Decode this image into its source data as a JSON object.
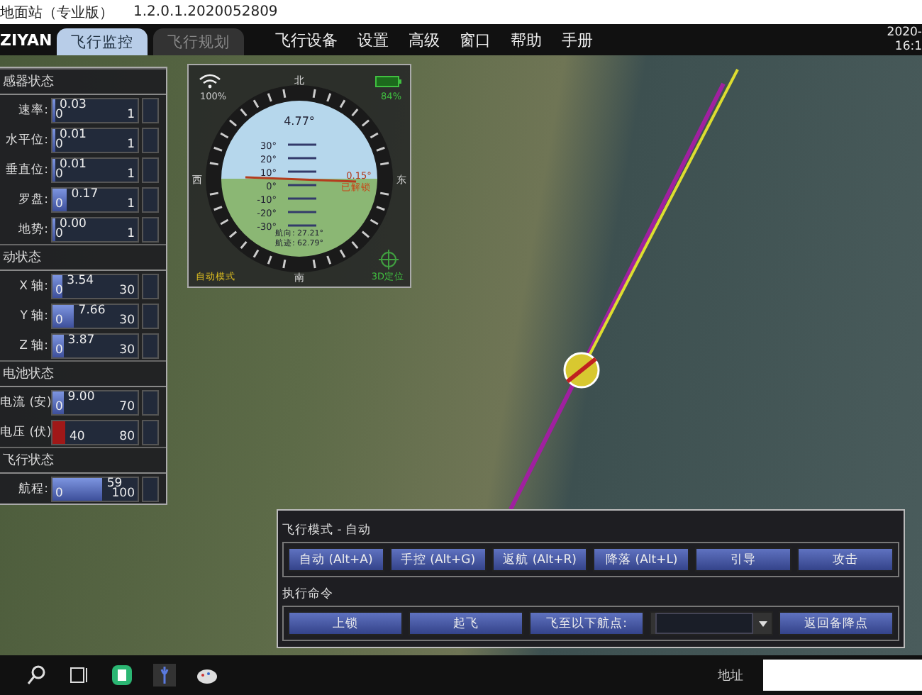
{
  "window": {
    "title": "地面站（专业版）",
    "version": "1.2.0.1.2020052809"
  },
  "menubar": {
    "logo": "ZIYAN",
    "tabs": [
      {
        "label": "飞行监控",
        "selected": true
      },
      {
        "label": "飞行规划",
        "selected": false
      }
    ],
    "menus": [
      "飞行设备",
      "设置",
      "高级",
      "窗口",
      "帮助",
      "手册"
    ],
    "date": "2020-",
    "time": "16:1"
  },
  "status_panel": {
    "sections": [
      {
        "title": "感器状态",
        "rows": [
          {
            "label": "速率:",
            "value": "0.03",
            "min": "0",
            "max": "1",
            "level": 0.03,
            "alarm": false
          },
          {
            "label": "水平位:",
            "value": "0.01",
            "min": "0",
            "max": "1",
            "level": 0.01,
            "alarm": false
          },
          {
            "label": "垂直位:",
            "value": "0.01",
            "min": "0",
            "max": "1",
            "level": 0.01,
            "alarm": false
          },
          {
            "label": "罗盘:",
            "value": "0.17",
            "min": "0",
            "max": "1",
            "level": 0.17,
            "alarm": false
          },
          {
            "label": "地势:",
            "value": "0.00",
            "min": "0",
            "max": "1",
            "level": 0.0,
            "alarm": false
          }
        ]
      },
      {
        "title": "动状态",
        "rows": [
          {
            "label": "X 轴:",
            "value": "3.54",
            "min": "0",
            "max": "30",
            "level": 0.118,
            "alarm": false
          },
          {
            "label": "Y 轴:",
            "value": "7.66",
            "min": "0",
            "max": "30",
            "level": 0.255,
            "alarm": false
          },
          {
            "label": "Z 轴:",
            "value": "3.87",
            "min": "0",
            "max": "30",
            "level": 0.129,
            "alarm": false
          }
        ]
      },
      {
        "title": "电池状态",
        "rows": [
          {
            "label": "电流 (安):",
            "value": "9.00",
            "min": "0",
            "max": "70",
            "level": 0.13,
            "alarm": false
          },
          {
            "label": "电压 (伏):",
            "min": "40",
            "max": "80",
            "level": 0.15,
            "alarm": true
          }
        ]
      },
      {
        "title": "飞行状态",
        "rows": [
          {
            "label": "航程:",
            "value": "59",
            "min": "0",
            "max": "100",
            "level": 0.59,
            "alarm": false
          }
        ]
      }
    ]
  },
  "attitude": {
    "signal": "100%",
    "battery": "84%",
    "north": "北",
    "west": "西",
    "east": "东",
    "south": "南",
    "pitch": "4.77°",
    "ladder": [
      "30°",
      "20°",
      "10°",
      "0°",
      "-10°",
      "-20°",
      "-30°"
    ],
    "roll": "0.15°",
    "arm_status": "已解锁",
    "heading": "航向: 27.21°",
    "track": "航迹: 62.79°",
    "mode": "自动模式",
    "gps": "3D定位"
  },
  "control_panel": {
    "mode_title": "飞行模式 - 自动",
    "mode_buttons": [
      "自动 (Alt+A)",
      "手控 (Alt+G)",
      "返航 (Alt+R)",
      "降落 (Alt+L)",
      "引导",
      "攻击"
    ],
    "command_title": "执行命令",
    "commands": [
      {
        "kind": "button",
        "label": "上锁"
      },
      {
        "kind": "button",
        "label": "起飞"
      },
      {
        "kind": "button",
        "label": "飞至以下航点:"
      },
      {
        "kind": "dropdown"
      },
      {
        "kind": "button",
        "label": "返回备降点"
      }
    ]
  },
  "taskbar": {
    "address_label": "地址"
  }
}
